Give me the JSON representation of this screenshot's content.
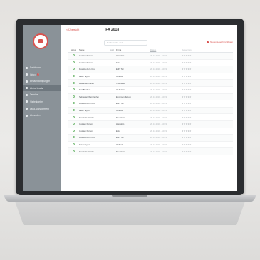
{
  "app": {
    "back_label": "< Übersicht",
    "page_title": "IFA 2018"
  },
  "sidebar": {
    "items": [
      {
        "label": "Dashboard",
        "active": false
      },
      {
        "label": "Inbox",
        "badge": "3",
        "active": false
      },
      {
        "label": "Benachrichtigungen",
        "active": false
      },
      {
        "label": "Aktive Leads",
        "active": true
      },
      {
        "label": "Termine",
        "active": false
      },
      {
        "label": "Visitenkarten",
        "active": false
      },
      {
        "label": "Lead-Management",
        "active": false
      },
      {
        "label": "Abmelden",
        "active": false
      }
    ]
  },
  "toolbar": {
    "search_placeholder": "Suche nach Leads ...",
    "action_label": "Neuen Lead hinzufügen"
  },
  "table": {
    "headers": [
      "Status",
      "Name",
      "Notiz",
      "Firma",
      "Datum",
      "Bewertung"
    ],
    "rows": [
      {
        "name": "Quinten Kortum",
        "note": "",
        "firma": "Humofon",
        "datum": "20.11.2018 - 10:21",
        "rating": "★★★★★"
      },
      {
        "name": "Quinten Kortum",
        "note": "",
        "firma": "Effor",
        "datum": "20.11.2018 - 10:21",
        "rating": "★★★★★"
      },
      {
        "name": "Rosetta da la Cruz",
        "note": "",
        "firma": "EMV Tel",
        "datum": "20.11.2018 - 10:21",
        "rating": "★★★★★"
      },
      {
        "name": "Peter Taylor",
        "note": "",
        "firma": "Onfrock",
        "datum": "20.11.2018 - 10:21",
        "rating": "★★★★★"
      },
      {
        "name": "Dashinder Darko",
        "note": "",
        "firma": "Treecle.io",
        "datum": "20.11.2018 - 10:21",
        "rating": "★★★★★"
      },
      {
        "name": "Kori Brothers",
        "note": "",
        "firma": "Z3 Telcom",
        "datum": "20.11.2018 - 10:21",
        "rating": "★★★★★"
      },
      {
        "name": "Sebastian Weinzapfen",
        "note": "",
        "firma": "Exxsmon Telcom",
        "datum": "20.11.2018 - 10:21",
        "rating": "★★★★★"
      },
      {
        "name": "Rosetta da la Cruz",
        "note": "",
        "firma": "EMV Tel",
        "datum": "20.11.2018 - 10:21",
        "rating": "★★★★★"
      },
      {
        "name": "Peter Taylor",
        "note": "",
        "firma": "Onfrock",
        "datum": "20.11.2018 - 10:21",
        "rating": "★★★★★"
      },
      {
        "name": "Dashinder Darko",
        "note": "",
        "firma": "Treecle.io",
        "datum": "20.11.2018 - 10:21",
        "rating": "★★★★★"
      },
      {
        "name": "Quinten Kortum",
        "note": "",
        "firma": "Humofon",
        "datum": "20.11.2018 - 10:21",
        "rating": "★★★★★"
      },
      {
        "name": "Quinten Kortum",
        "note": "",
        "firma": "Effor",
        "datum": "20.11.2018 - 10:21",
        "rating": "★★★★★"
      },
      {
        "name": "Rosetta da la Cruz",
        "note": "",
        "firma": "EMV Tel",
        "datum": "20.11.2018 - 10:21",
        "rating": "★★★★★"
      },
      {
        "name": "Peter Taylor",
        "note": "",
        "firma": "Onfrock",
        "datum": "20.11.2018 - 10:21",
        "rating": "★★★★★"
      },
      {
        "name": "Dashinder Darko",
        "note": "",
        "firma": "Treecle.io",
        "datum": "20.11.2018 - 10:21",
        "rating": "★★★★★"
      }
    ]
  },
  "colors": {
    "accent": "#d9534f",
    "sidebar": "#8a9298",
    "status_ok": "#7fbf7f"
  },
  "icons": {
    "logo": "brand-logo-icon",
    "status": "status-circle-icon",
    "add": "plus-icon"
  }
}
